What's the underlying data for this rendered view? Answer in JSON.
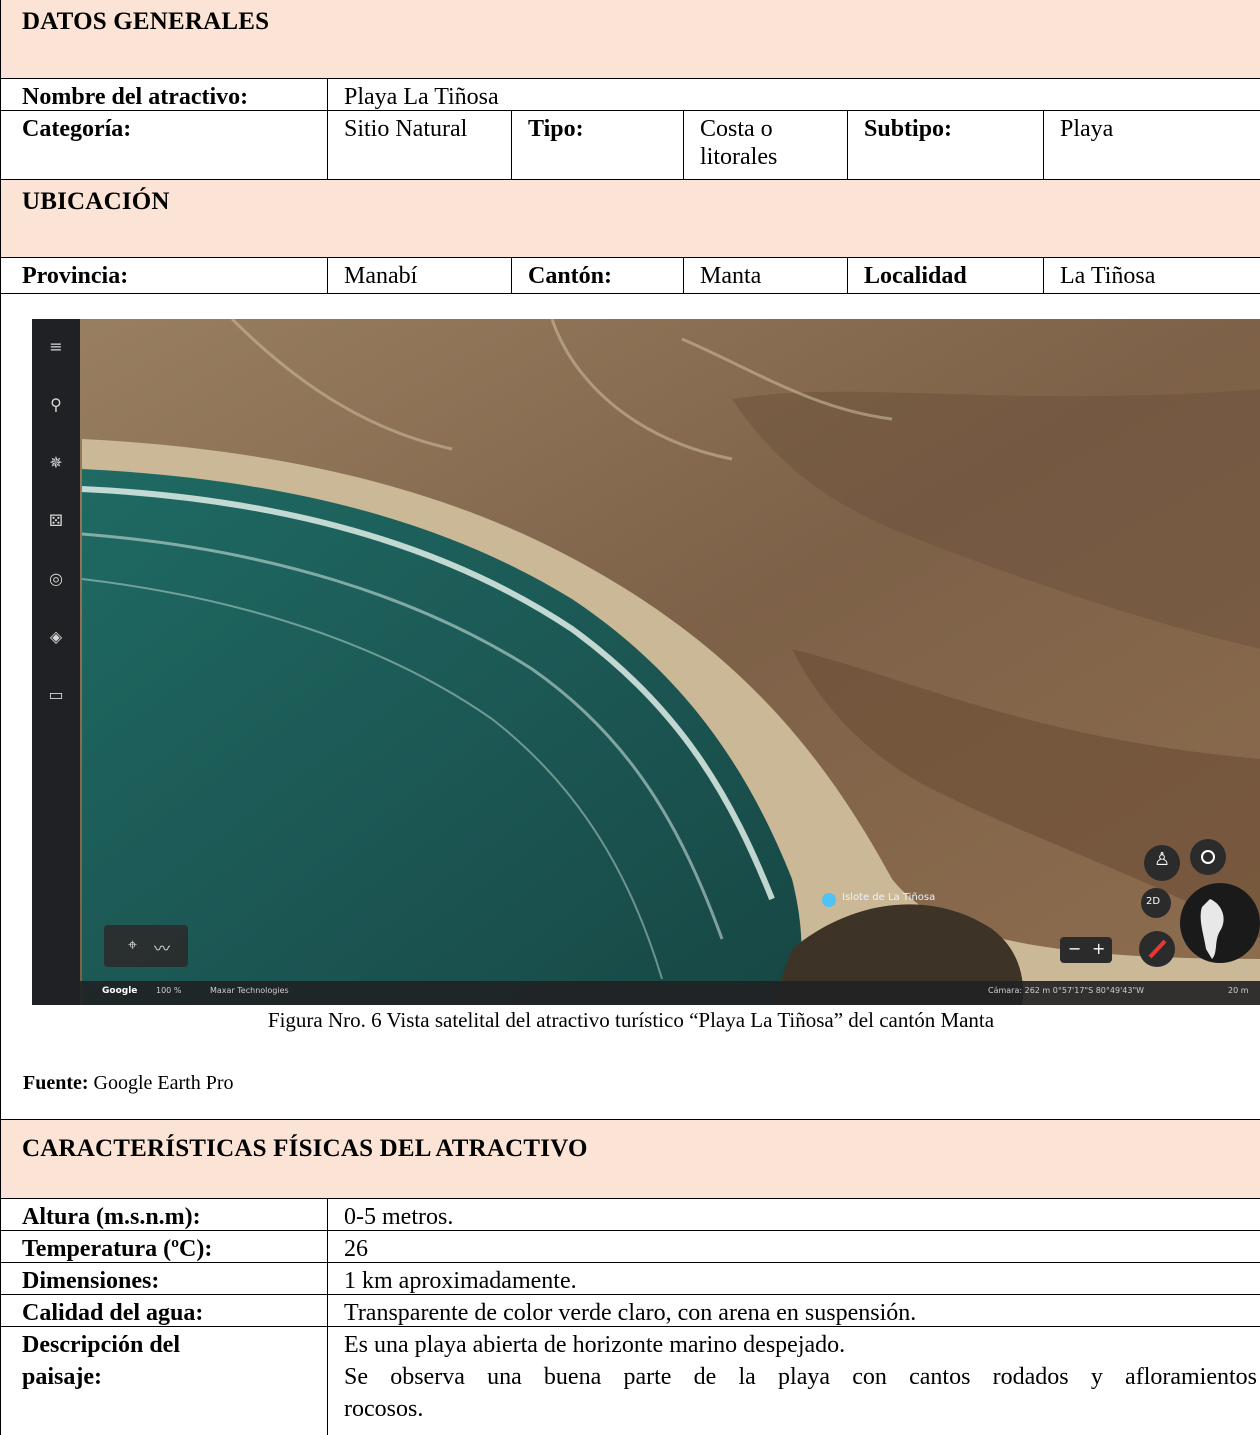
{
  "general": {
    "title": "DATOS GENERALES",
    "name_label": "Nombre del atractivo:",
    "name_value": "Playa La Tiñosa",
    "category_label": "Categoría:",
    "category_value": "Sitio Natural",
    "type_label": "Tipo:",
    "type_value_1": "Costa o",
    "type_value_2": "litorales",
    "subtype_label": "Subtipo:",
    "subtype_value": "Playa"
  },
  "location": {
    "title": "UBICACIÓN",
    "province_label": "Provincia:",
    "province_value": "Manabí",
    "canton_label": "Cantón:",
    "canton_value": "Manta",
    "locality_label": "Localidad",
    "locality_value": "La Tiñosa"
  },
  "figure": {
    "place_label": "Islote de La Tiñosa",
    "google_label": "Google",
    "zoom_label": "100 %",
    "provider_label": "Maxar Technologies",
    "camera_label": "Cámara: 262 m  0°57'17\"S 80°49'43\"W",
    "scale_label": "20 m",
    "mode_label": "2D",
    "caption": "Figura Nro.  6 Vista satelital del atractivo turístico “Playa La Tiñosa” del cantón Manta",
    "source_label": "Fuente:",
    "source_value": " Google Earth Pro",
    "icons": [
      "menu-icon",
      "search-icon",
      "voyager-icon",
      "random-icon",
      "pegman-icon",
      "layers-icon",
      "ruler-icon",
      "placemark-icon",
      "path-icon",
      "street-view-icon",
      "location-icon",
      "compass-icon",
      "globe-icon"
    ]
  },
  "physical": {
    "title": "CARACTERÍSTICAS FÍSICAS DEL ATRACTIVO",
    "rows": [
      {
        "label": "Altura (m.s.n.m):",
        "value": "0-5 metros."
      },
      {
        "label": "Temperatura (ºC):",
        "value": "26"
      },
      {
        "label": "Dimensiones:",
        "value": "1 km aproximadamente."
      },
      {
        "label": "Calidad del agua:",
        "value": "Transparente de color verde claro, con arena en suspensión."
      }
    ],
    "desc_label_1": "Descripción del",
    "desc_label_2": "paisaje:",
    "desc_line_1": "Es una playa abierta de horizonte marino despejado.",
    "desc_line_2": "Se observa una buena parte de la playa con cantos rodados y afloramientos",
    "desc_line_3": "rocosos."
  },
  "colors": {
    "band": "#fbe4d5",
    "sea": "#1d5a55",
    "land": "#8a6a4a"
  }
}
